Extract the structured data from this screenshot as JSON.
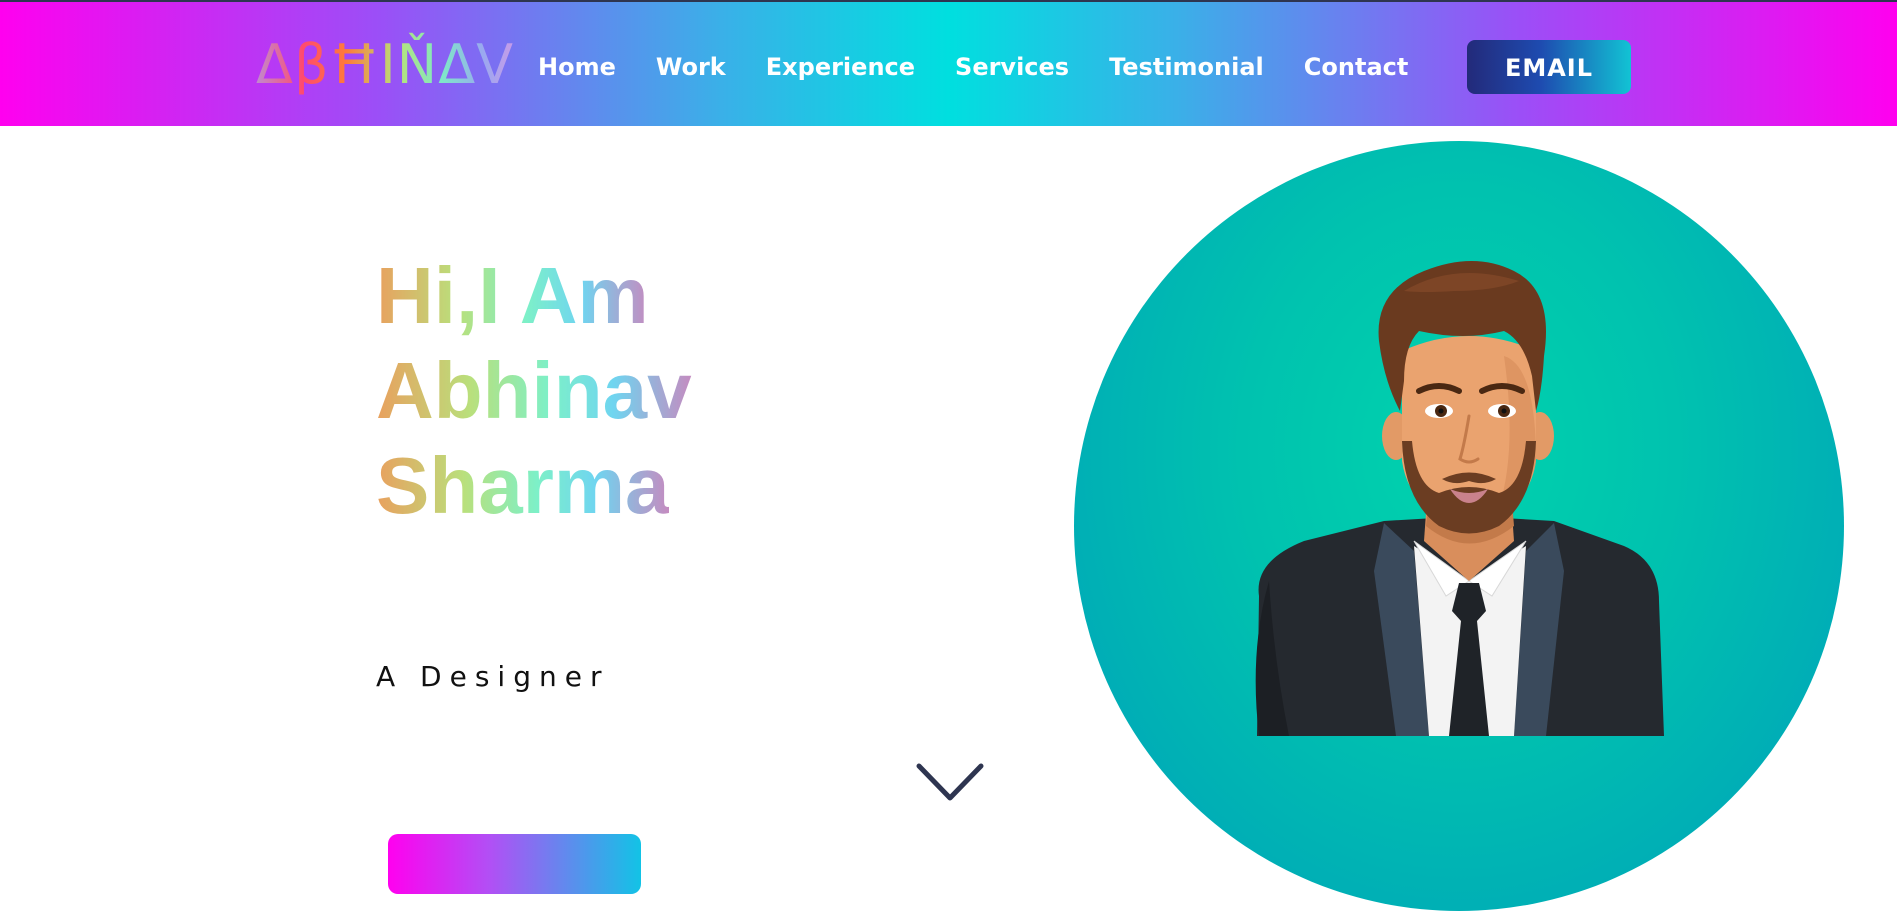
{
  "brand": {
    "logo_text": "ΔβĦIŇΔV"
  },
  "nav": {
    "links": [
      "Home",
      "Work",
      "Experience",
      "Services",
      "Testimonial",
      "Contact"
    ],
    "email_label": "EMAIL"
  },
  "hero": {
    "heading_lines": [
      "Hi,I Am",
      "Abhinav",
      "Sharma"
    ],
    "subtitle": "A Designer"
  },
  "colors": {
    "nav_gradient": [
      "#ff00ef",
      "#00dfdf"
    ],
    "avatar_bg": "#00c2af",
    "email_button": [
      "#232a7a",
      "#12c3d4"
    ]
  },
  "icons": {
    "scroll_down": "chevron-down-icon",
    "avatar": "avatar-illustration"
  }
}
